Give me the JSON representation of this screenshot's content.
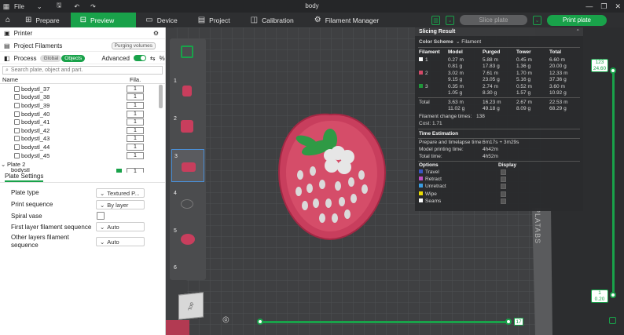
{
  "window": {
    "title": "body",
    "menu_file": "File"
  },
  "tabs": [
    {
      "label": "Prepare",
      "icon": "prepare-icon"
    },
    {
      "label": "Preview",
      "icon": "preview-icon",
      "active": true
    },
    {
      "label": "Device",
      "icon": "device-icon"
    },
    {
      "label": "Project",
      "icon": "project-icon"
    },
    {
      "label": "Calibration",
      "icon": "calibration-icon"
    },
    {
      "label": "Filament Manager",
      "icon": "filament-manager-icon"
    }
  ],
  "toolbar": {
    "slice_label": "Slice plate",
    "print_label": "Print plate"
  },
  "sidebar": {
    "printer_label": "Printer",
    "project_filaments_label": "Project Filaments",
    "purging_volumes_label": "Purging volumes",
    "process_label": "Process",
    "global_label": "Global",
    "objects_label": "Objects",
    "advanced_label": "Advanced",
    "search_placeholder": "Search plate, object and part.",
    "col_name": "Name",
    "col_fila": "Fila.",
    "objects": [
      {
        "name": "bodystl_37",
        "fila": "1"
      },
      {
        "name": "bodystl_38",
        "fila": "1"
      },
      {
        "name": "bodystl_39",
        "fila": "1"
      },
      {
        "name": "bodystl_40",
        "fila": "1"
      },
      {
        "name": "bodystl_41",
        "fila": "1"
      },
      {
        "name": "bodystl_42",
        "fila": "1"
      },
      {
        "name": "bodystl_43",
        "fila": "1"
      },
      {
        "name": "bodystl_44",
        "fila": "1"
      },
      {
        "name": "bodystl_45",
        "fila": "1"
      }
    ],
    "plate2_label": "Plate 2",
    "plate2_first": "bodystl",
    "plate2_fila": "1"
  },
  "plate_settings": {
    "title": "Plate Settings",
    "plate_type_label": "Plate type",
    "plate_type_value": "Textured P...",
    "print_sequence_label": "Print sequence",
    "print_sequence_value": "By layer",
    "spiral_vase_label": "Spiral vase",
    "first_layer_label": "First layer filament sequence",
    "first_layer_value": "Auto",
    "other_layers_label_1": "Other layers filament",
    "other_layers_label_2": "sequence",
    "other_layers_value": "Auto"
  },
  "plates": [
    "1",
    "2",
    "3",
    "4",
    "5",
    "6"
  ],
  "slicing": {
    "title": "Slicing Result",
    "color_scheme_label": "Color Scheme",
    "color_scheme_value": "Filament",
    "headers": [
      "Filament",
      "Model",
      "Purged",
      "Tower",
      "Total"
    ],
    "rows": [
      {
        "id": "1",
        "color": "#ffffff",
        "model": [
          "0.27 m",
          "0.81 g"
        ],
        "purged": [
          "5.88 m",
          "17.83 g"
        ],
        "tower": [
          "0.45 m",
          "1.36 g"
        ],
        "total": [
          "6.60 m",
          "20.00 g"
        ]
      },
      {
        "id": "2",
        "color": "#d94a6a",
        "model": [
          "3.02 m",
          "9.15 g"
        ],
        "purged": [
          "7.61 m",
          "23.05 g"
        ],
        "tower": [
          "1.70 m",
          "5.16 g"
        ],
        "total": [
          "12.33 m",
          "37.36 g"
        ]
      },
      {
        "id": "3",
        "color": "#1f9a3a",
        "model": [
          "0.35 m",
          "1.05 g"
        ],
        "purged": [
          "2.74 m",
          "8.30 g"
        ],
        "tower": [
          "0.52 m",
          "1.57 g"
        ],
        "total": [
          "3.60 m",
          "10.92 g"
        ]
      }
    ],
    "total_label": "Total",
    "total": {
      "model": [
        "3.63 m",
        "11.02 g"
      ],
      "purged": [
        "16.23 m",
        "49.18 g"
      ],
      "tower": [
        "2.67 m",
        "8.09 g"
      ],
      "total": [
        "22.53 m",
        "68.29 g"
      ]
    },
    "change_label": "Filament change times:",
    "change_value": "138",
    "cost_label": "Cost:",
    "cost_value": "1.71",
    "time_title": "Time Estimation",
    "prepare_label": "Prepare and timelapse time:",
    "prepare_value": "6m17s + 3m29s",
    "model_time_label": "Model printing time:",
    "model_time_value": "4h42m",
    "total_time_label": "Total time:",
    "total_time_value": "4h52m",
    "options_label": "Options",
    "display_label": "Display",
    "options": [
      {
        "label": "Travel",
        "color": "#3a58c8"
      },
      {
        "label": "Retract",
        "color": "#c44fc9"
      },
      {
        "label": "Unretract",
        "color": "#3aa0e8"
      },
      {
        "label": "Wipe",
        "color": "#f0e000"
      },
      {
        "label": "Seams",
        "color": "#ffffff"
      }
    ]
  },
  "layer_slider": {
    "top_value": "123",
    "top_height": "24.60",
    "bottom_value": "1",
    "bottom_height": "0.20"
  },
  "move_slider": {
    "value": "17"
  },
  "view_cube_label": "Top",
  "bed_text": "PLATABS"
}
